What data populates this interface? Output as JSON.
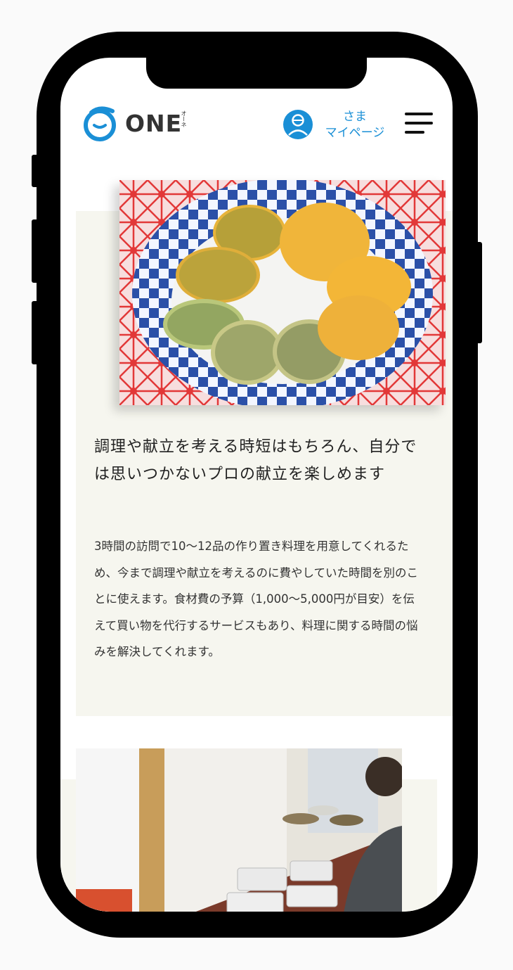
{
  "brand": {
    "logo_text": "ONE",
    "logo_kana": "オーネ",
    "brand_color": "#1a8fd6"
  },
  "header": {
    "greeting": "さま",
    "mypage_label": "マイページ",
    "avatar_icon": "user-avatar-icon",
    "menu_icon": "hamburger-menu-icon"
  },
  "section1": {
    "image_alt": "food-dish-photo",
    "headline": "調理や献立を考える時短はもちろん、自分では思いつかないプロの献立を楽しめます",
    "body": "3時間の訪問で10〜12品の作り置き料理を用意してくれるため、今まで調理や献立を考えるのに費やしていた時間を別のことに使えます。食材費の予算（1,000〜5,000円が目安）を伝えて買い物を代行するサービスもあり、料理に関する時間の悩みを解決してくれます。"
  },
  "section2": {
    "image_alt": "meal-prep-containers-photo"
  },
  "colors": {
    "card_bg": "#f6f6ef",
    "text": "#333333"
  }
}
